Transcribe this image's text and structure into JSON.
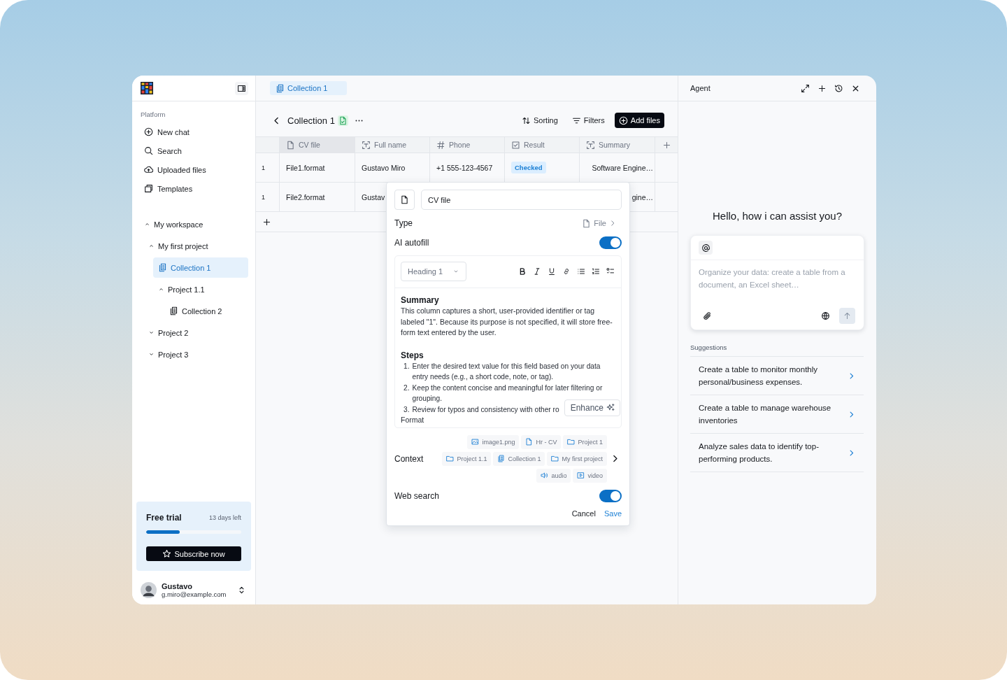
{
  "sidebar": {
    "section_label": "Platform",
    "nav_items": [
      {
        "label": "New chat",
        "kind": "new"
      },
      {
        "label": "Search",
        "kind": "search"
      },
      {
        "label": "Uploaded files",
        "kind": "upload"
      },
      {
        "label": "Templates",
        "kind": "templates"
      }
    ],
    "tree": [
      {
        "label": "My workspace",
        "kind": "folder",
        "expanded": true,
        "selected": false,
        "children": [
          {
            "label": "My first project",
            "kind": "folder",
            "expanded": true,
            "selected": false,
            "children": [
              {
                "label": "Collection 1",
                "kind": "collection",
                "selected": true
              },
              {
                "label": "Project 1.1",
                "kind": "folder",
                "expanded": true,
                "selected": false,
                "children": [
                  {
                    "label": "Collection 2",
                    "kind": "collection",
                    "selected": false
                  }
                ]
              }
            ]
          },
          {
            "label": "Project 2",
            "kind": "folder",
            "expanded": false,
            "selected": false
          },
          {
            "label": "Project 3",
            "kind": "folder",
            "expanded": false,
            "selected": false
          }
        ]
      }
    ],
    "trial": {
      "title": "Free trial",
      "remaining": "13 days left",
      "level": 0.35,
      "button": "Subscribe now"
    },
    "user": {
      "name": "Gustavo",
      "email": "g.miro@example.com"
    }
  },
  "tabs": [
    {
      "label": "Collection 1",
      "selected": true
    }
  ],
  "toolbar": {
    "title": "Collection 1",
    "buttons": [
      {
        "label": "Sorting",
        "kind": "sort"
      },
      {
        "label": "Filters",
        "kind": "filter"
      },
      {
        "label": "Add files",
        "kind": "add"
      }
    ]
  },
  "table": {
    "columns": [
      {
        "label": "CV file",
        "kind": "file",
        "selected": true
      },
      {
        "label": "Full name",
        "kind": "text",
        "selected": false
      },
      {
        "label": "Phone",
        "kind": "number",
        "selected": false
      },
      {
        "label": "Result",
        "kind": "checkbox",
        "selected": false
      },
      {
        "label": "Summary",
        "kind": "text",
        "selected": false
      }
    ],
    "rows": [
      {
        "number": "1",
        "cv_file": "File1.format",
        "full_name": "Gustavo Miro",
        "phone": "+1 555-123-4567",
        "result": "Checked",
        "summary": "Software Engine…"
      },
      {
        "number": "1",
        "cv_file": "File2.format",
        "full_name": "Gustav",
        "summary": "gine…"
      }
    ]
  },
  "column_editor": {
    "name_value": "CV file",
    "type_label": "Type",
    "type_value": "File",
    "autofill_label": "AI autofill",
    "autofill_on": true,
    "editor": {
      "block_style": "Heading 1",
      "sections": [
        {
          "heading": "Summary",
          "paragraph": "This column captures a short, user-provided identifier or tag labeled \"1\". Because its purpose is not specified, it will store free-form text entered by the user."
        },
        {
          "heading": "Steps",
          "steps": [
            {
              "number": "1.",
              "text": "Enter the desired text value for this field based on your data entry needs (e.g., a short code, note, or tag)."
            },
            {
              "number": "2.",
              "text": "Keep the content concise and meaningful for later filtering or grouping."
            },
            {
              "number": "3.",
              "text": "Review for typos and consistency with other ro"
            }
          ]
        }
      ],
      "trailing_text": "Format",
      "enhance_button": "Enhance"
    },
    "context": {
      "label": "Context",
      "chips": [
        {
          "label": "image1.png",
          "kind": "image"
        },
        {
          "label": "Hr - CV",
          "kind": "file"
        },
        {
          "label": "Project 1",
          "kind": "folder"
        },
        {
          "label": "Project 1.1",
          "kind": "folder"
        },
        {
          "label": "Collection 1",
          "kind": "collection"
        },
        {
          "label": "My first project",
          "kind": "folder"
        },
        {
          "label": "audio",
          "kind": "audio"
        },
        {
          "label": "video",
          "kind": "video"
        }
      ]
    },
    "web_search_label": "Web search",
    "web_search_on": true,
    "cancel": "Cancel",
    "save": "Save"
  },
  "agent": {
    "title": "Agent",
    "greeting": "Hello, how i can assist you?",
    "placeholder": "Organize your data: create a table from a document, an Excel sheet…",
    "suggestions_label": "Suggestions",
    "suggestions": [
      "Create a table to monitor monthly personal/business expenses.",
      "Create a table to manage warehouse inventories",
      "Analyze sales data to identify top-performing products."
    ]
  }
}
